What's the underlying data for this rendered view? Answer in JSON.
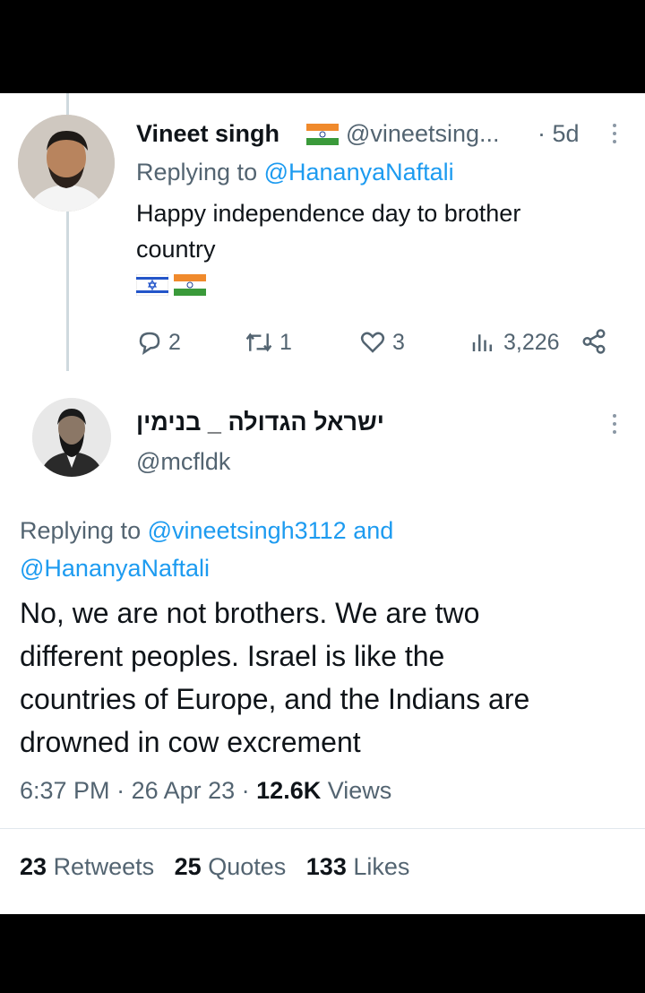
{
  "reply": {
    "author_name": "Vineet singh",
    "author_handle": "@vineetsing...",
    "age": "· 5d",
    "replying_prefix": "Replying to",
    "replying_to": "@HananyaNaftali",
    "text_line1": "Happy independence day to brother",
    "text_line2": "country",
    "flags": [
      "israel-flag",
      "india-flag"
    ],
    "reply_count": "2",
    "retweet_count": "1",
    "like_count": "3",
    "view_count": "3,226"
  },
  "main": {
    "author_name": "ישראל הגדולה _ בנימין",
    "author_handle": "@mcfldk",
    "replying_prefix": "Replying to",
    "replying_to_1": "@vineetsingh3112",
    "and_word": "and",
    "replying_to_2": "@HananyaNaftali",
    "body_lines": [
      "No, we are not brothers. We are two",
      "different peoples. Israel is like the",
      "countries of Europe, and the Indians are",
      "drowned in cow excrement"
    ],
    "time": "6:37 PM",
    "date": "26 Apr 23",
    "views_count": "12.6K",
    "views_label": "Views",
    "retweets_count": "23",
    "retweets_label": "Retweets",
    "quotes_count": "25",
    "quotes_label": "Quotes",
    "likes_count": "133",
    "likes_label": "Likes"
  }
}
